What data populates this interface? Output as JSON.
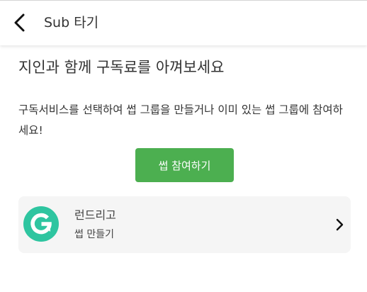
{
  "header": {
    "back_icon": "arrow-left-icon",
    "title": "Sub 타기"
  },
  "main": {
    "headline": "지인과 함께 구독료를 아껴보세요",
    "description": "구독서비스를 선택하여 썹 그룹을 만들거나 이미 있는 썹 그룹에 참여하세요!",
    "join_button_label": "썹 참여하기"
  },
  "service_card": {
    "logo_icon": "grammarly-g-logo",
    "name": "런드리고",
    "subtitle": "썹 만들기",
    "chevron_icon": "chevron-right-icon"
  },
  "colors": {
    "accent_green": "#4caf50",
    "logo_teal": "#2ec5a0",
    "card_background": "#f5f5f5",
    "text_primary": "#333333"
  }
}
